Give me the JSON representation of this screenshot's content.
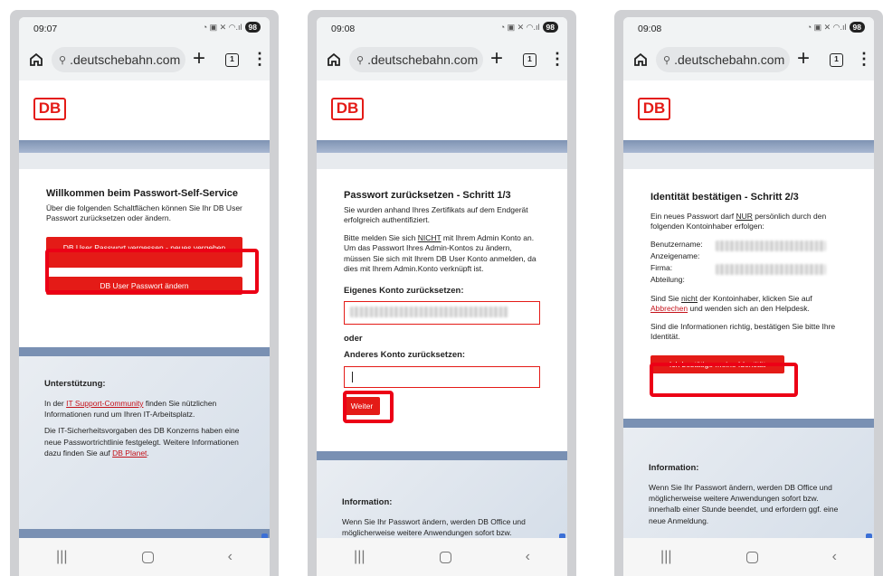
{
  "browser": {
    "url": ".deutschebahn.com",
    "battery": "98",
    "times": [
      "09:07",
      "09:08",
      "09:08"
    ]
  },
  "logo": "DB",
  "colors": {
    "db_red": "#e41b17",
    "highlight": "#ec0016",
    "blue_bar": "#7f93b3"
  },
  "screen1": {
    "title": "Willkommen beim Passwort-Self-Service",
    "intro": "Über die folgenden Schaltflächen können Sie Ihr DB User Passwort zurücksetzen oder ändern.",
    "btn_forgot": "DB User Passwort vergessen - neues vergeben",
    "btn_change": "DB User Passwort ändern",
    "support_title": "Unterstützung:",
    "support_p1_pre": "In der ",
    "support_p1_link": "IT Support-Community",
    "support_p1_post": " finden Sie nützlichen Informationen rund um Ihren IT-Arbeitsplatz.",
    "support_p2_pre": "Die IT-Sicherheitsvorgaben des DB Konzerns haben eine neue Passwortrichtlinie festgelegt. Weitere Informationen dazu finden Sie auf ",
    "support_p2_link": "DB Planet",
    "support_p2_post": "."
  },
  "screen2": {
    "title": "Passwort zurücksetzen - Schritt 1/3",
    "p1": "Sie wurden anhand Ihres Zertifikats auf dem Endgerät erfolgreich authentifiziert.",
    "p2_pre": "Bitte melden Sie sich ",
    "p2_nicht": "NICHT",
    "p2_post": " mit Ihrem Admin Konto an. Um das Passwort Ihres Admin-Kontos zu ändern, müssen Sie sich mit Ihrem DB User Konto anmelden, da dies mit Ihrem Admin.Konto verknüpft ist.",
    "own_label": "Eigenes Konto zurücksetzen:",
    "or": "oder",
    "other_label": "Anderes Konto zurücksetzen:",
    "btn_next": "Weiter",
    "info_title": "Information:",
    "info_text": "Wenn Sie Ihr Passwort ändern, werden DB Office und möglicherweise weitere Anwendungen sofort bzw. innerhalb einer"
  },
  "screen3": {
    "title": "Identität bestätigen - Schritt 2/3",
    "p1_pre": "Ein neues Passwort darf ",
    "p1_nur": "NUR",
    "p1_post": " persönlich durch den folgenden Kontoinhaber erfolgen:",
    "fields": [
      "Benutzername:",
      "Anzeigename:",
      "Firma:",
      "Abteilung:"
    ],
    "p2_pre": "Sind Sie ",
    "p2_nicht": "nicht",
    "p2_mid": " der Kontoinhaber, klicken Sie auf ",
    "p2_link": "Abbrechen",
    "p2_post": " und wenden sich an den Helpdesk.",
    "p3": "Sind die Informationen richtig, bestätigen Sie bitte Ihre Identität.",
    "btn_confirm": "Ich bestätige meine Identität",
    "info_title": "Information:",
    "info_text": "Wenn Sie Ihr Passwort ändern, werden DB Office und möglicherweise weitere Anwendungen sofort bzw. innerhalb einer Stunde beendet, und erfordern ggf. eine neue Anmeldung."
  }
}
